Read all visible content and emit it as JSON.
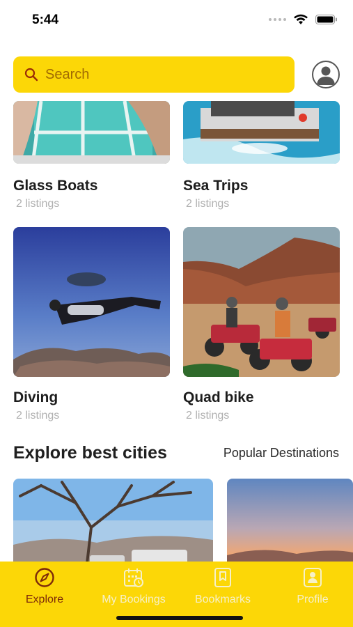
{
  "status_bar": {
    "time": "5:44"
  },
  "search": {
    "placeholder": "Search"
  },
  "categories": [
    {
      "title": "Glass Boats",
      "listings": "2 listings"
    },
    {
      "title": "Sea Trips",
      "listings": "2 listings"
    },
    {
      "title": "Diving",
      "listings": "2 listings"
    },
    {
      "title": "Quad bike",
      "listings": "2 listings"
    }
  ],
  "cities_section": {
    "title": "Explore best cities",
    "link": "Popular Destinations"
  },
  "tab_bar": {
    "tabs": [
      {
        "label": "Explore",
        "icon": "compass-icon",
        "active": true
      },
      {
        "label": "My Bookings",
        "icon": "calendar-icon",
        "active": false
      },
      {
        "label": "Bookmarks",
        "icon": "bookmark-icon",
        "active": false
      },
      {
        "label": "Profile",
        "icon": "profile-icon",
        "active": false
      }
    ]
  },
  "colors": {
    "accent": "#fcd707",
    "active_tab": "#7d2a0a",
    "inactive_tab": "#f6f0c8"
  }
}
